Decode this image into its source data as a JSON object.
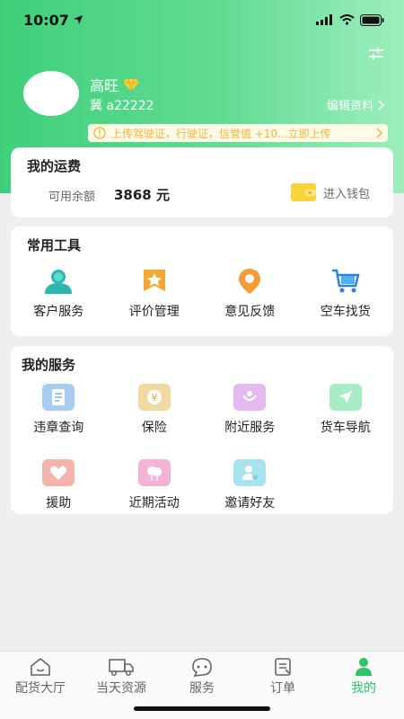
{
  "status_bar": {
    "time": "10:07"
  },
  "profile": {
    "name": "高旺",
    "user_id": "冀 a22222",
    "edit_label": "编辑资料",
    "banner_text": "上传驾驶证，行驶证，信誉值 +10...立即上传"
  },
  "freight": {
    "title": "我的运费",
    "balance_label": "可用余额",
    "balance_value": "3868 元",
    "wallet_label": "进入钱包"
  },
  "tools": {
    "title": "常用工具",
    "items": [
      {
        "label": "客户服务",
        "icon": "customer-service-icon"
      },
      {
        "label": "评价管理",
        "icon": "rating-icon"
      },
      {
        "label": "意见反馈",
        "icon": "feedback-icon"
      },
      {
        "label": "空车找货",
        "icon": "cart-icon"
      }
    ]
  },
  "services": {
    "title": "我的服务",
    "items": [
      {
        "label": "违章查询",
        "icon": "violation-icon",
        "color": "#a9cdf0"
      },
      {
        "label": "保险",
        "icon": "insurance-icon",
        "color": "#f0d9a2"
      },
      {
        "label": "附近服务",
        "icon": "nearby-icon",
        "color": "#e6b8f0"
      },
      {
        "label": "货车导航",
        "icon": "navigation-icon",
        "color": "#a8ecc6"
      },
      {
        "label": "援助",
        "icon": "aid-icon",
        "color": "#f3b4ac"
      },
      {
        "label": "近期活动",
        "icon": "activity-icon",
        "color": "#f3b3d6"
      },
      {
        "label": "邀请好友",
        "icon": "invite-icon",
        "color": "#a6e3ef"
      }
    ]
  },
  "tabbar": {
    "tabs": [
      {
        "label": "配货大厅",
        "icon": "home-icon"
      },
      {
        "label": "当天资源",
        "icon": "truck-icon"
      },
      {
        "label": "服务",
        "icon": "service-icon"
      },
      {
        "label": "订单",
        "icon": "order-icon"
      },
      {
        "label": "我的",
        "icon": "profile-icon"
      }
    ],
    "active_index": 4
  },
  "colors": {
    "accent": "#2fc36a",
    "banner_text": "#f3b43b"
  }
}
